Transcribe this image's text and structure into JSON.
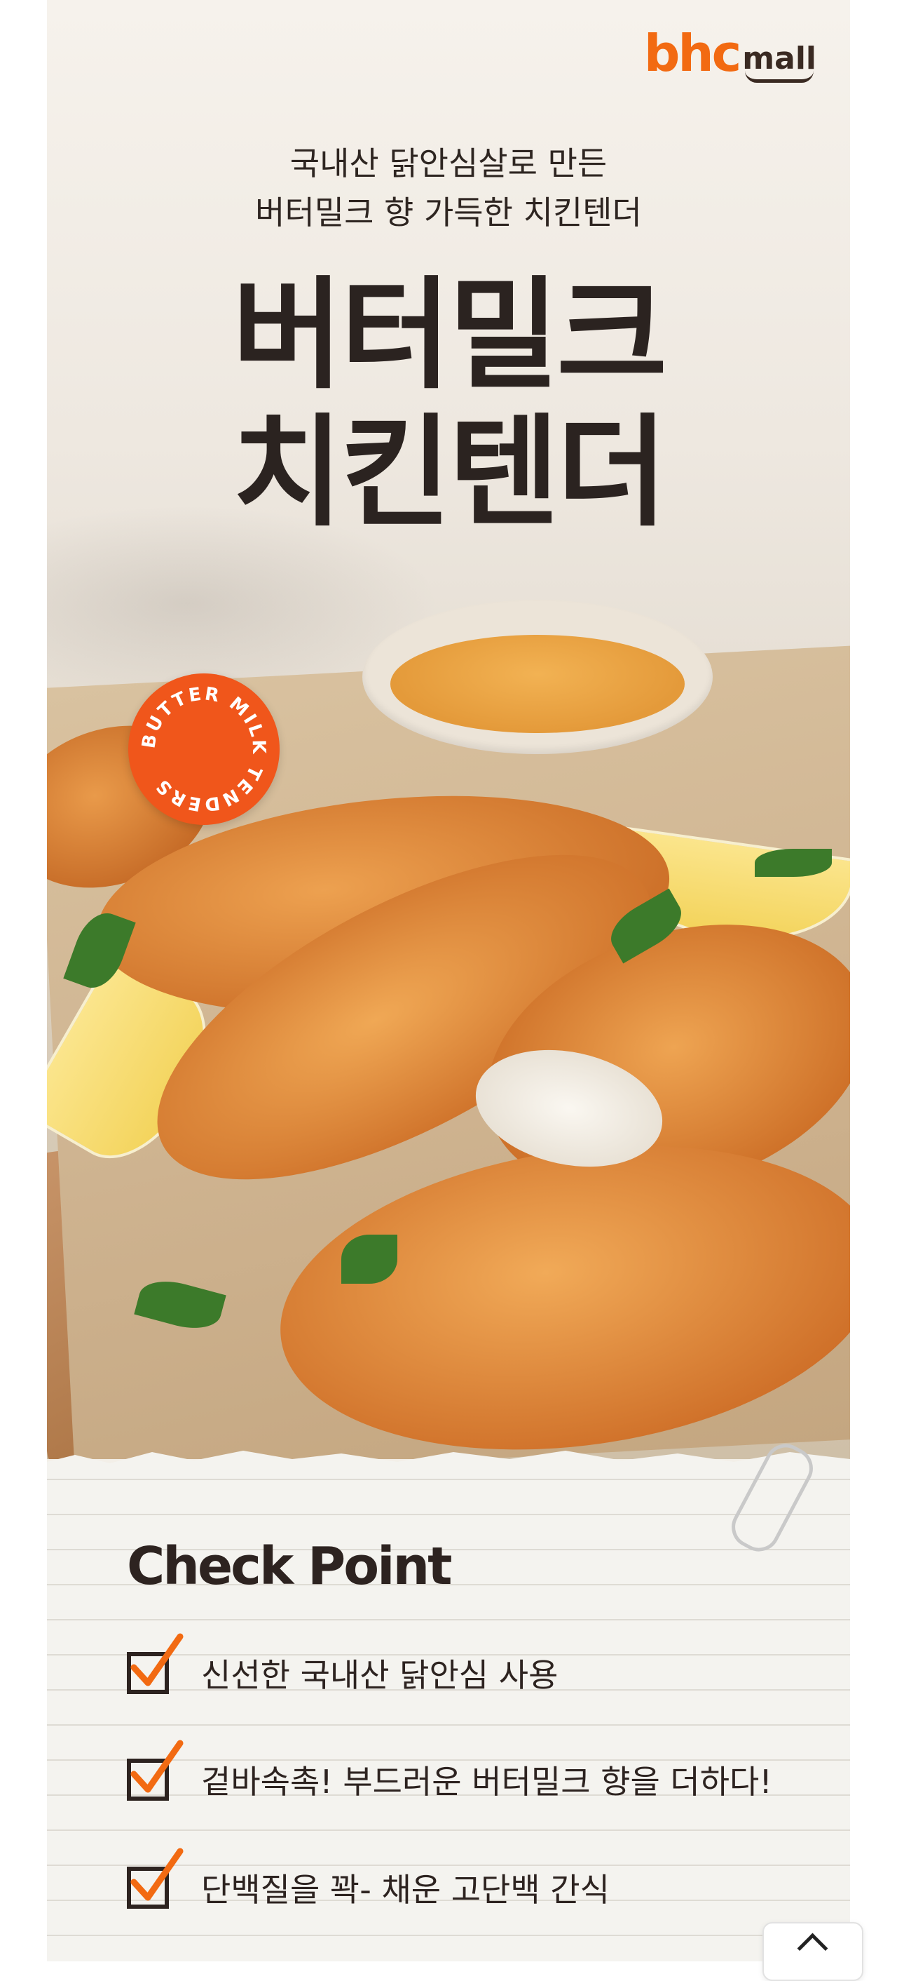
{
  "brand": {
    "logo_main": "bhc",
    "logo_sub": "mall"
  },
  "hero": {
    "subtitle_line1": "국내산 닭안심살로 만든",
    "subtitle_line2": "버터밀크 향 가득한  치킨텐더",
    "headline_line1": "버터밀크",
    "headline_line2": "치킨텐더",
    "badge_text": "BUTTER MILK TENDERS"
  },
  "check_point": {
    "title": "Check Point",
    "items": [
      "신선한 국내산 닭안심 사용",
      "겉바속촉! 부드러운 버터밀크 향을 더하다!",
      "단백질을 꽉- 채운 고단백 간식"
    ]
  },
  "colors": {
    "accent": "#f26a12",
    "badge": "#f0561b",
    "text_dark": "#2d2320",
    "check_mark": "#f26a12"
  },
  "icons": {
    "check": "check-icon",
    "scroll_top": "arrow-up-icon",
    "paperclip": "paperclip-icon"
  }
}
